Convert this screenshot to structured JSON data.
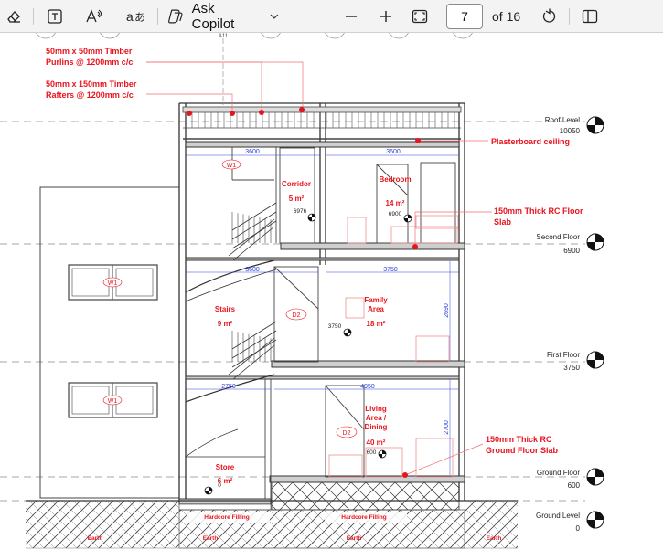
{
  "toolbar": {
    "erase_icon": "eraser-icon",
    "text_icon": "text-box-icon",
    "read_aloud_icon": "read-aloud-icon",
    "translate_icon": "translate-icon",
    "copilot_label": "Ask Copilot",
    "zoom_out_icon": "minus-icon",
    "zoom_in_icon": "plus-icon",
    "fit_icon": "fit-page-icon",
    "page_number": "7",
    "page_total": "of 16",
    "rotate_icon": "rotate-icon",
    "view_icon": "page-view-icon"
  },
  "annotations": {
    "purlins_line1": "50mm x 50mm Timber",
    "purlins_line2": "Purlins @ 1200mm c/c",
    "rafters_line1": "50mm x 150mm Timber",
    "rafters_line2": "Rafters @ 1200mm c/c",
    "ceiling": "Plasterboard ceiling",
    "floor_slab_line1": "150mm Thick RC Floor",
    "floor_slab_line2": "Slab",
    "ground_slab_line1": "150mm Thick RC",
    "ground_slab_line2": "Ground Floor Slab"
  },
  "levels": {
    "roof_label": "Roof Level",
    "roof_value": "10050",
    "second_label": "Second Floor",
    "second_value": "6900",
    "first_label": "First Floor",
    "first_value": "3750",
    "ground_label": "Ground Floor",
    "ground_value": "600",
    "groundlevel_label": "Ground Level",
    "groundlevel_value": "0"
  },
  "rooms": {
    "corridor_name": "Corridor",
    "corridor_area": "5 m²",
    "bedroom_name": "Bedroom",
    "bedroom_area": "14 m²",
    "stairs_name": "Stairs",
    "stairs_area": "9 m²",
    "family_line1": "Family",
    "family_line2": "Area",
    "family_area": "18 m²",
    "living_line1": "Living",
    "living_line2": "Area /",
    "living_line3": "Dining",
    "living_area": "40 m²",
    "store_name": "Store",
    "store_area": "6 m²"
  },
  "dims": {
    "d3600a": "3600",
    "d3600b": "3600",
    "d3600c": "3600",
    "d3750": "3750",
    "d4950": "4950",
    "d2690": "2690",
    "d2700": "2700",
    "d2750": "2750",
    "spot6976": "6976",
    "spot6900": "6900",
    "spot3750": "3750",
    "spot600": "600",
    "spot0": "0"
  },
  "tags": {
    "w1a": "W1",
    "w1b": "W1",
    "w1c": "W1",
    "d2a": "D2",
    "d2b": "D2",
    "grid": "A11"
  },
  "ground": {
    "hardcore1": "Hardcore Filling",
    "hardcore2": "Hardcore Filling",
    "earth": "Earth"
  },
  "colors": {
    "annotation_red": "#e8141e",
    "dimension_blue": "#2a40d8",
    "line_grey": "#555555"
  }
}
